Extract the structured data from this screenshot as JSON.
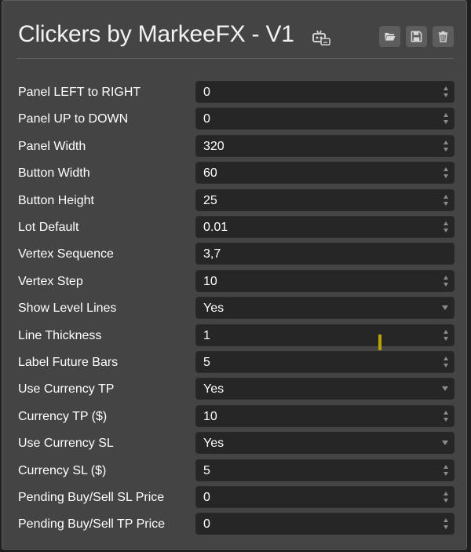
{
  "window": {
    "title": "Clickers by MarkeeFX - V1",
    "title_icon": "robot-monitor-icon",
    "buttons": [
      {
        "name": "open-folder-button",
        "icon": "folder-open-icon"
      },
      {
        "name": "save-button",
        "icon": "floppy-disk-icon"
      },
      {
        "name": "delete-button",
        "icon": "trash-icon"
      }
    ]
  },
  "settings": [
    {
      "label": "Panel LEFT to RIGHT",
      "value": "0",
      "control": "spinner"
    },
    {
      "label": "Panel UP to DOWN",
      "value": "0",
      "control": "spinner"
    },
    {
      "label": "Panel Width",
      "value": "320",
      "control": "spinner"
    },
    {
      "label": "Button Width",
      "value": "60",
      "control": "spinner"
    },
    {
      "label": "Button Height",
      "value": "25",
      "control": "spinner"
    },
    {
      "label": "Lot Default",
      "value": "0.01",
      "control": "spinner"
    },
    {
      "label": "Vertex Sequence",
      "value": "3,7",
      "control": "text"
    },
    {
      "label": "Vertex Step",
      "value": "10",
      "control": "spinner"
    },
    {
      "label": "Show Level Lines",
      "value": "Yes",
      "control": "select"
    },
    {
      "label": "Line Thickness",
      "value": "1",
      "control": "spinner"
    },
    {
      "label": "Label Future Bars",
      "value": "5",
      "control": "spinner"
    },
    {
      "label": "Use Currency TP",
      "value": "Yes",
      "control": "select"
    },
    {
      "label": "Currency TP ($)",
      "value": "10",
      "control": "spinner"
    },
    {
      "label": "Use Currency SL",
      "value": "Yes",
      "control": "select"
    },
    {
      "label": "Currency SL ($)",
      "value": "5",
      "control": "spinner"
    },
    {
      "label": "Pending Buy/Sell SL Price",
      "value": "0",
      "control": "spinner"
    },
    {
      "label": "Pending Buy/Sell TP Price",
      "value": "0",
      "control": "spinner"
    }
  ],
  "colors": {
    "panel_bg": "#444444",
    "field_bg": "#262626",
    "text": "#ffffff",
    "accent_cursor": "#b8a400"
  }
}
